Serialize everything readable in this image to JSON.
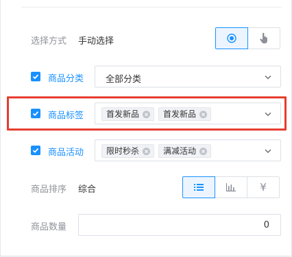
{
  "selection_mode": {
    "label": "选择方式",
    "value": "手动选择",
    "buttons": [
      {
        "icon": "radio-target-icon",
        "active": true
      },
      {
        "icon": "hand-pointer-icon",
        "active": false
      }
    ]
  },
  "category": {
    "label": "商品分类",
    "checked": true,
    "selected": "全部分类"
  },
  "tags": {
    "label": "商品标签",
    "checked": true,
    "chips": [
      "首发新品",
      "首发新品"
    ]
  },
  "activity": {
    "label": "商品活动",
    "checked": true,
    "chips": [
      "限时秒杀",
      "满减活动"
    ]
  },
  "sort": {
    "label": "商品排序",
    "value": "综合",
    "options": [
      {
        "icon": "list-icon",
        "active": true
      },
      {
        "icon": "bar-chart-icon",
        "active": false
      },
      {
        "icon": "yen-icon",
        "glyph": "¥",
        "active": false
      }
    ]
  },
  "quantity": {
    "label": "商品数量",
    "value": "0"
  },
  "colors": {
    "accent": "#1890ff",
    "highlight": "#e63c2e"
  }
}
